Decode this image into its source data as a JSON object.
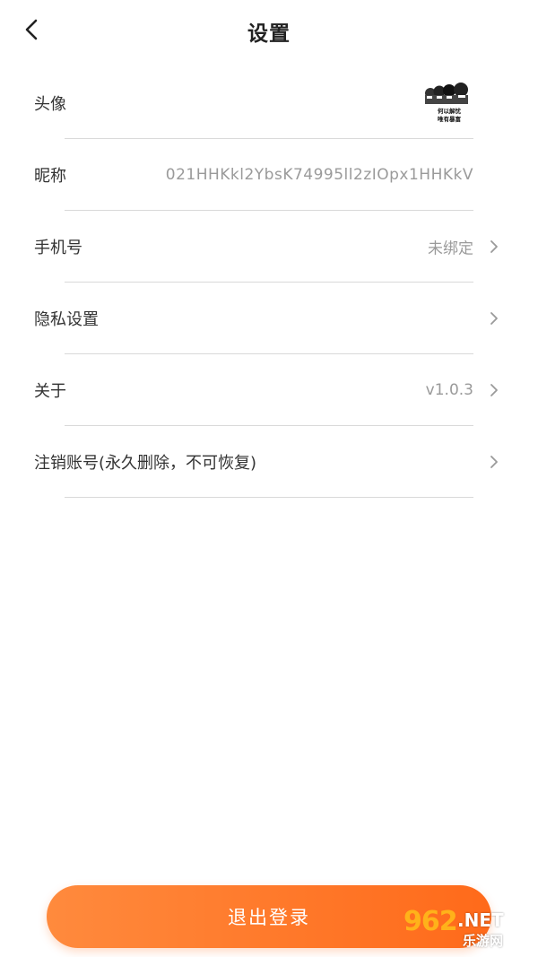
{
  "header": {
    "title": "设置"
  },
  "rows": [
    {
      "label": "头像",
      "value": "",
      "chevron": false
    },
    {
      "label": "昵称",
      "value": "021HHKkl2YbsK74995ll2zIOpx1HHKkV",
      "chevron": false
    },
    {
      "label": "手机号",
      "value": "未绑定",
      "chevron": true
    },
    {
      "label": "隐私设置",
      "value": "",
      "chevron": true
    },
    {
      "label": "关于",
      "value": "v1.0.3",
      "chevron": true
    },
    {
      "label": "注销账号(永久删除，不可恢复)",
      "value": "",
      "chevron": true
    }
  ],
  "avatar": {
    "caption_line1": "何以解忧",
    "caption_line2": "唯有暴富"
  },
  "logout": {
    "label": "退出登录"
  },
  "watermark": {
    "number": "962",
    "suffix": ".NET",
    "sub": "乐游网"
  },
  "colors": {
    "accent": "#ff7a2a",
    "text": "#333333",
    "muted": "#9a9a9a",
    "divider": "#d9d9d9"
  },
  "icons": {
    "back": "chevron-left-icon",
    "row_arrow": "chevron-right-icon"
  }
}
